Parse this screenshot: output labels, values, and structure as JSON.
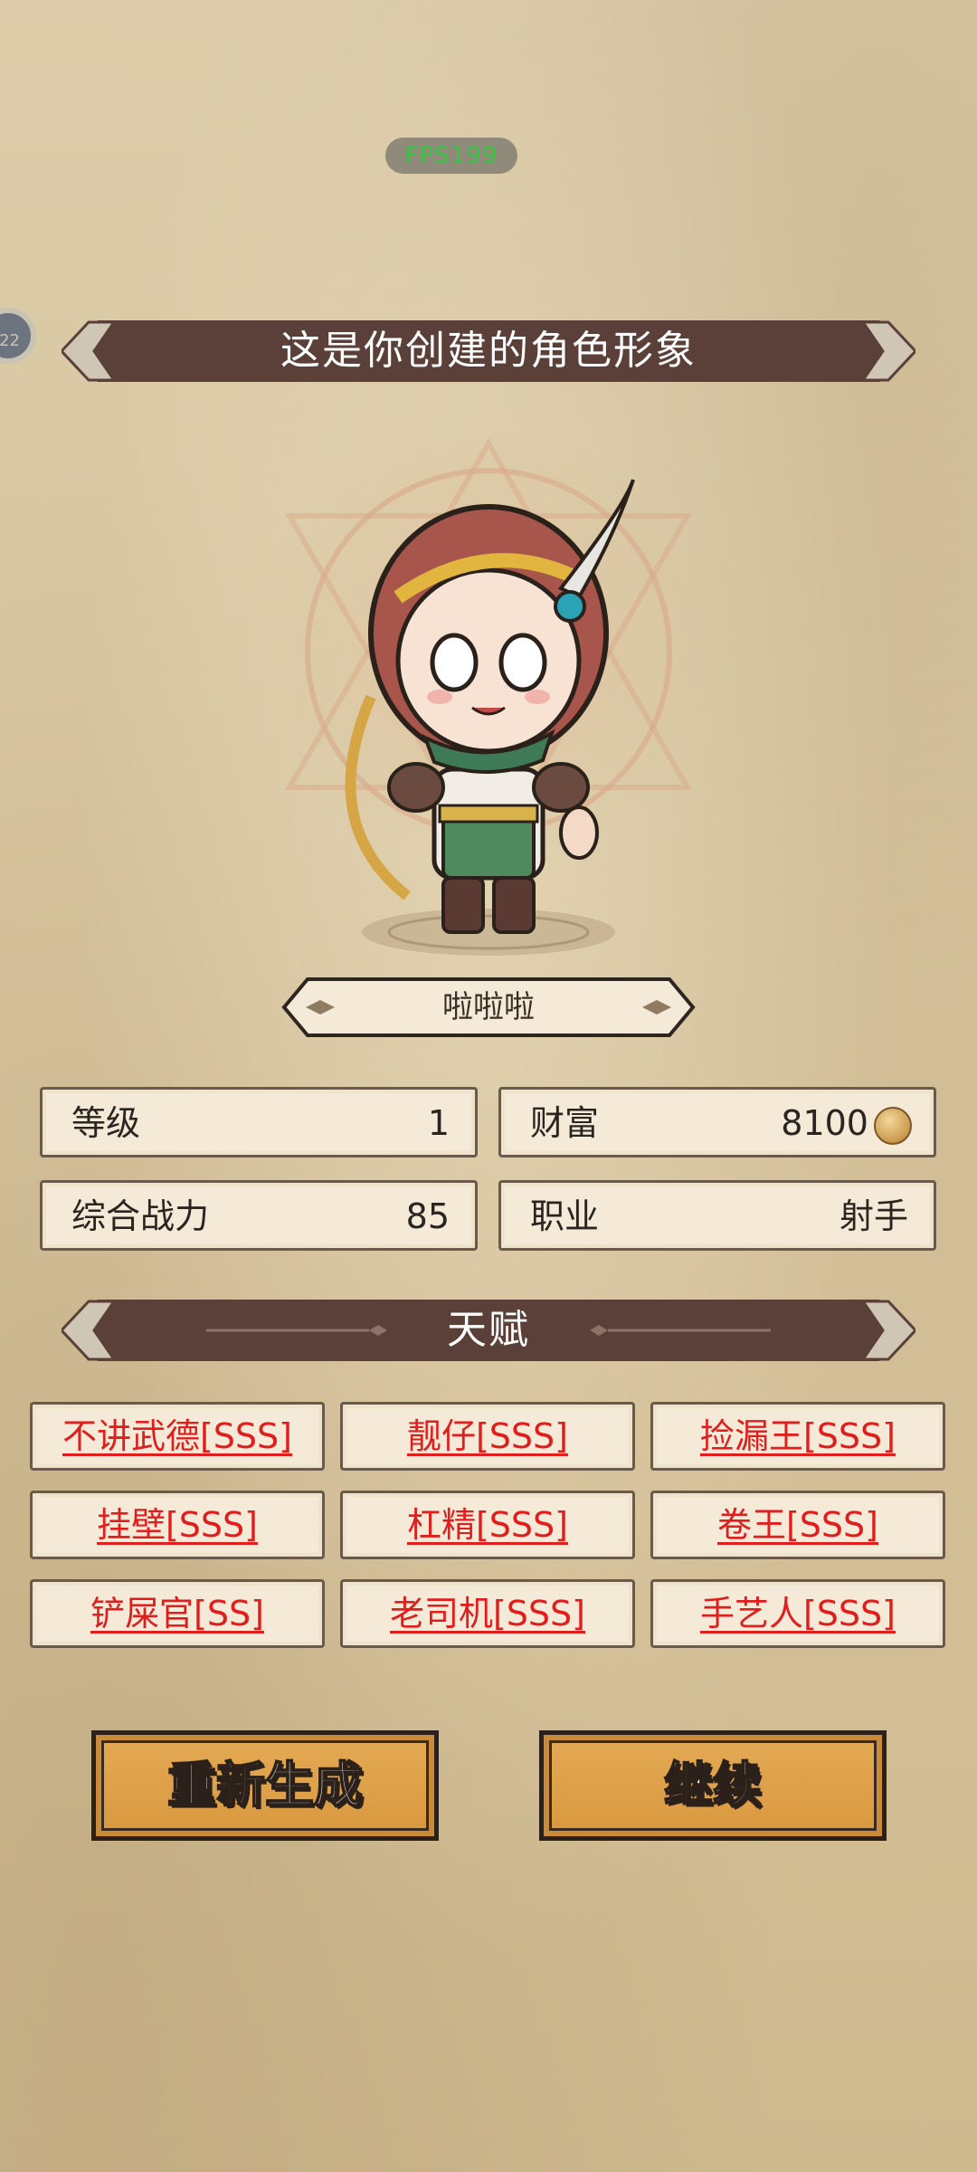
{
  "fps": "FPS199",
  "side_badge": "22",
  "header": {
    "title": "这是你创建的角色形象"
  },
  "character": {
    "name": "啦啦啦"
  },
  "stats": {
    "level_label": "等级",
    "level_value": "1",
    "wealth_label": "财富",
    "wealth_value": "8100",
    "power_label": "综合战力",
    "power_value": "85",
    "job_label": "职业",
    "job_value": "射手"
  },
  "talent_section": {
    "title": "天赋"
  },
  "talents": [
    "不讲武德[SSS]",
    "靓仔[SSS]",
    "捡漏王[SSS]",
    "挂壁[SSS]",
    "杠精[SSS]",
    "卷王[SSS]",
    "铲屎官[SS]",
    "老司机[SSS]",
    "手艺人[SSS]"
  ],
  "buttons": {
    "regenerate": "重新生成",
    "continue": "继续"
  },
  "colors": {
    "banner": "#5a4038",
    "talent_text": "#e01e1e",
    "button": "#e0a24d",
    "fps_text": "#35c742"
  },
  "icons": {
    "wealth": "gold-coin-icon"
  }
}
